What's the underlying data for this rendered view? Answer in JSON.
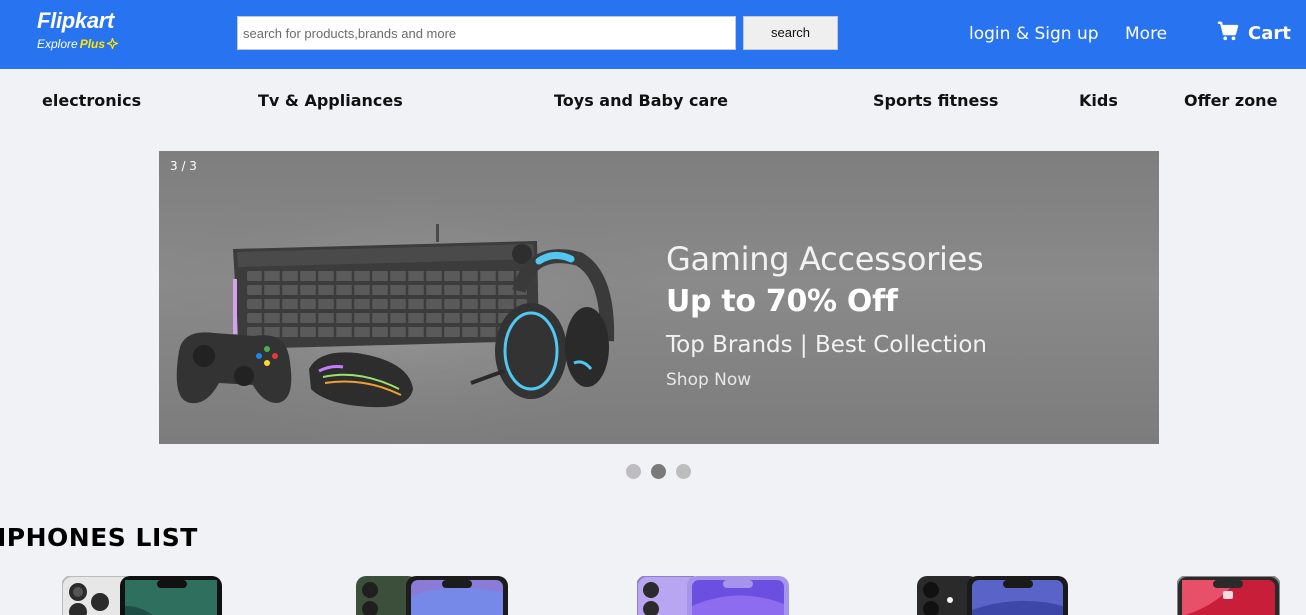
{
  "header": {
    "logo": {
      "brand": "Flipkart",
      "tagline_explore": "Explore",
      "tagline_plus": "Plus"
    },
    "search": {
      "placeholder": "search for products,brands and more",
      "value": "",
      "button_label": "search"
    },
    "login_label": "login & Sign up",
    "more_label": "More",
    "cart_label": "Cart"
  },
  "categories": [
    {
      "label": "electronics"
    },
    {
      "label": "Tv & Appliances"
    },
    {
      "label": "Toys and Baby care"
    },
    {
      "label": "Sports fitness"
    },
    {
      "label": "Kids"
    },
    {
      "label": "Offer zone"
    }
  ],
  "banner": {
    "counter": "3 / 3",
    "title": "Gaming Accessories",
    "offer": "Up to 70% Off",
    "subtitle": "Top Brands | Best Collection",
    "cta": "Shop Now",
    "slides_total": 3,
    "active_dot": 2
  },
  "iphones": {
    "title": "IPHONES LIST",
    "items": [
      {
        "name": "iphone-silver-green",
        "accent": "#2f6f5e"
      },
      {
        "name": "iphone-alpine-green",
        "accent": "#8a7bd6"
      },
      {
        "name": "iphone-purple",
        "accent": "#8e6cf0"
      },
      {
        "name": "iphone-black",
        "accent": "#5a63c8"
      },
      {
        "name": "iphone-red",
        "accent": "#c81e3a"
      }
    ]
  },
  "colors": {
    "header_bg": "#2874f0",
    "page_bg": "#f1f2f6",
    "plus_yellow": "#ffe500"
  }
}
